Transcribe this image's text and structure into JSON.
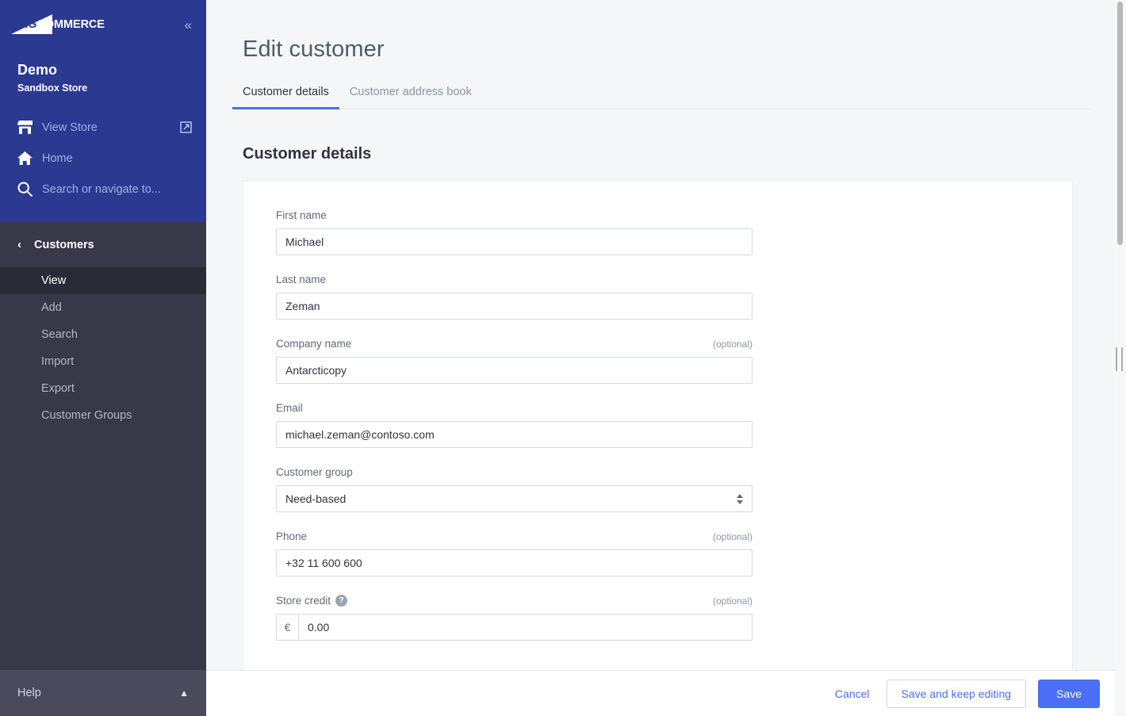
{
  "sidebar": {
    "logo_text_big": "BIG",
    "logo_text_rest": "COMMERCE",
    "collapse_icon": "chevron-double-left-icon",
    "store_name": "Demo",
    "store_subtitle": "Sandbox Store",
    "links": [
      {
        "label": "View Store",
        "icon": "storefront-icon",
        "external": true
      },
      {
        "label": "Home",
        "icon": "home-icon",
        "external": false
      },
      {
        "label": "Search or navigate to...",
        "icon": "search-icon",
        "external": false
      }
    ],
    "nav_section": {
      "title": "Customers",
      "back_icon": "chevron-left-icon",
      "items": [
        {
          "label": "View",
          "active": true
        },
        {
          "label": "Add",
          "active": false
        },
        {
          "label": "Search",
          "active": false
        },
        {
          "label": "Import",
          "active": false
        },
        {
          "label": "Export",
          "active": false
        },
        {
          "label": "Customer Groups",
          "active": false
        }
      ]
    },
    "help": {
      "label": "Help",
      "chevron": "chevron-up-icon"
    }
  },
  "main": {
    "page_title": "Edit customer",
    "tabs": [
      {
        "label": "Customer details",
        "active": true
      },
      {
        "label": "Customer address book",
        "active": false
      }
    ],
    "section_title": "Customer details",
    "optional_label": "(optional)",
    "fields": [
      {
        "label": "First name",
        "value": "Michael",
        "optional": false,
        "type": "text"
      },
      {
        "label": "Last name",
        "value": "Zeman",
        "optional": false,
        "type": "text"
      },
      {
        "label": "Company name",
        "value": "Antarcticopy",
        "optional": true,
        "type": "text"
      },
      {
        "label": "Email",
        "value": "michael.zeman@contoso.com",
        "optional": false,
        "type": "text"
      },
      {
        "label": "Customer group",
        "value": "Need-based",
        "optional": false,
        "type": "select"
      },
      {
        "label": "Phone",
        "value": "+32 11 600 600",
        "optional": true,
        "type": "text"
      },
      {
        "label": "Store credit",
        "value": "0.00",
        "optional": true,
        "type": "money",
        "currency": "€",
        "help": "?"
      }
    ]
  },
  "action_bar": {
    "cancel_label": "Cancel",
    "save_keep_label": "Save and keep editing",
    "save_label": "Save"
  },
  "colors": {
    "sidebar_blue": "#2b3990",
    "nav_panel_dark": "#383849",
    "nav_active_dark": "#2b2b38",
    "help_bar": "#4a4a5c",
    "accent_blue": "#4a6ef5",
    "page_bg": "#f5f6f8",
    "heading": "#34313f"
  }
}
